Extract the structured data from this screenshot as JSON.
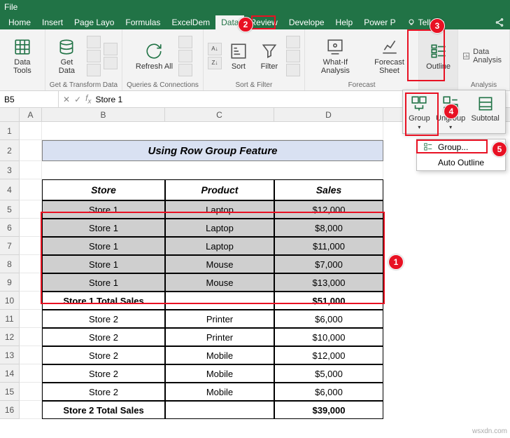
{
  "titlebar": {
    "file": "File"
  },
  "tabs": [
    "Home",
    "Insert",
    "Page Layo",
    "Formulas",
    "ExcelDem",
    "Data",
    "Review",
    "Develope",
    "Help",
    "Power P",
    "Tell me"
  ],
  "activeTab": "Data",
  "ribbon": {
    "dataTools": {
      "label": "Data Tools",
      "btn": "Data Tools"
    },
    "getTransform": {
      "label": "Get & Transform Data",
      "btn": "Get Data"
    },
    "queries": {
      "label": "Queries & Connections",
      "btn": "Refresh All"
    },
    "sortFilter": {
      "label": "Sort & Filter",
      "sort": "Sort",
      "filter": "Filter"
    },
    "forecast": {
      "label": "Forecast",
      "whatif": "What-If Analysis",
      "sheet": "Forecast Sheet"
    },
    "outline": {
      "label": "Outline",
      "btn": "Outline"
    },
    "analysis": {
      "label": "Analysis",
      "btn": "Data Analysis"
    }
  },
  "namebox": "B5",
  "formula": "Store 1",
  "colHeaders": [
    "A",
    "B",
    "C",
    "D"
  ],
  "rowHeaders": [
    "1",
    "2",
    "3",
    "4",
    "5",
    "6",
    "7",
    "8",
    "9",
    "10",
    "11",
    "12",
    "13",
    "14",
    "15",
    "16"
  ],
  "titleRow": "Using Row Group Feature",
  "headers": {
    "store": "Store",
    "product": "Product",
    "sales": "Sales"
  },
  "dataRows": [
    {
      "store": "Store 1",
      "product": "Laptop",
      "sales": "$12,000"
    },
    {
      "store": "Store 1",
      "product": "Laptop",
      "sales": "$8,000"
    },
    {
      "store": "Store 1",
      "product": "Laptop",
      "sales": "$11,000"
    },
    {
      "store": "Store 1",
      "product": "Mouse",
      "sales": "$7,000"
    },
    {
      "store": "Store 1",
      "product": "Mouse",
      "sales": "$13,000"
    }
  ],
  "total1": {
    "label": "Store 1 Total Sales",
    "value": "$51,000"
  },
  "dataRows2": [
    {
      "store": "Store 2",
      "product": "Printer",
      "sales": "$6,000"
    },
    {
      "store": "Store 2",
      "product": "Printer",
      "sales": "$10,000"
    },
    {
      "store": "Store 2",
      "product": "Mobile",
      "sales": "$12,000"
    },
    {
      "store": "Store 2",
      "product": "Mobile",
      "sales": "$5,000"
    },
    {
      "store": "Store 2",
      "product": "Mobile",
      "sales": "$6,000"
    }
  ],
  "total2": {
    "label": "Store 2 Total Sales",
    "value": "$39,000"
  },
  "outlinePop": {
    "group": "Group",
    "ungroup": "Ungroup",
    "subtotal": "Subtotal"
  },
  "groupMenu": {
    "group": "Group...",
    "auto": "Auto Outline"
  },
  "steps": {
    "s1": "1",
    "s2": "2",
    "s3": "3",
    "s4": "4",
    "s5": "5"
  },
  "watermark": "wsxdn.com"
}
